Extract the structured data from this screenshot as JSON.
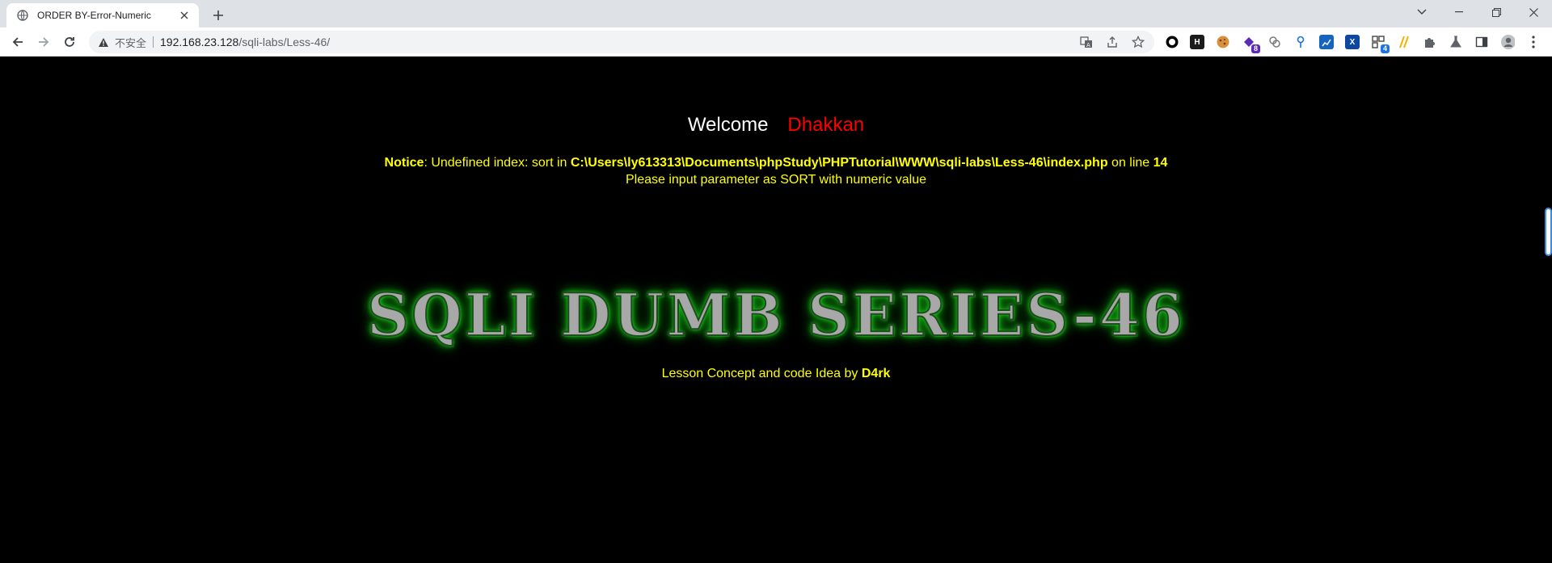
{
  "browser": {
    "tab_title": "ORDER BY-Error-Numeric",
    "omnibox": {
      "security_label": "不安全",
      "url_host": "192.168.23.128",
      "url_path": "/sqli-labs/Less-46/"
    },
    "extension_badges": {
      "puzzle_ext": "8",
      "qr_ext": "4"
    }
  },
  "page": {
    "welcome_label": "Welcome",
    "user_name": "Dhakkan",
    "notice": {
      "label": "Notice",
      "message": ": Undefined index: sort in ",
      "file_path": "C:\\Users\\ly613313\\Documents\\phpStudy\\PHPTutorial\\WWW\\sqli-labs\\Less-46\\index.php",
      "on_line_text": " on line ",
      "line_number": "14",
      "instruction": "Please input parameter as SORT with numeric value"
    },
    "banner_text": "SQLI DUMB SERIES-46",
    "credit": {
      "text": "Lesson Concept and code Idea by ",
      "author": "D4rk"
    }
  },
  "colors": {
    "welcome": "#ffffff",
    "user": "#ff0000",
    "notice": "#ffff00",
    "banner_glow": "#22dd22",
    "page_bg": "#000000"
  }
}
